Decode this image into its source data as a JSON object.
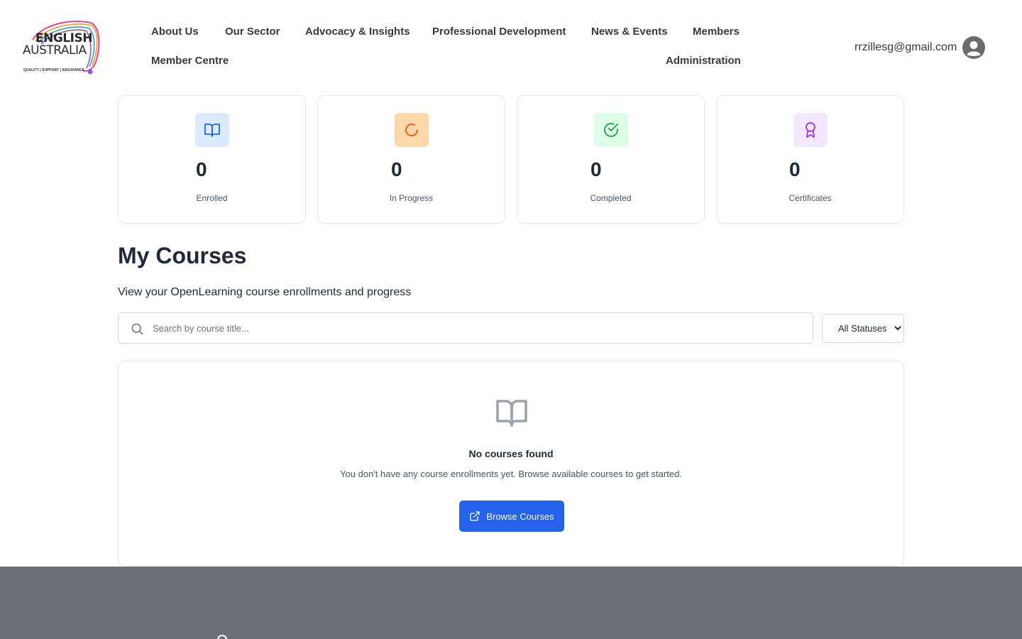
{
  "header": {
    "logo": {
      "line1": "ENGLISH",
      "line2": "AUSTRALIA",
      "tagline": "QUALITY | SUPPORT | ASSURANCE"
    },
    "nav": [
      {
        "label": "About Us"
      },
      {
        "label": "Our Sector"
      },
      {
        "label": "Advocacy & Insights"
      },
      {
        "label": "Professional Development"
      },
      {
        "label": "News & Events"
      },
      {
        "label": "Members"
      },
      {
        "label": "Member Centre"
      },
      {
        "label": "Administration"
      }
    ],
    "user_email": "rrzillesg@gmail.com",
    "avatar_icon": "user-circle-icon"
  },
  "stats": [
    {
      "value": "0",
      "label": "Enrolled",
      "icon": "book-open-icon",
      "bg": "#dbeafe",
      "color": "#2563eb"
    },
    {
      "value": "0",
      "label": "In Progress",
      "icon": "loader-icon",
      "bg": "#fed7aa",
      "color": "#ea580c"
    },
    {
      "value": "0",
      "label": "Completed",
      "icon": "check-circle-icon",
      "bg": "#dcfce7",
      "color": "#16a34a"
    },
    {
      "value": "0",
      "label": "Certificates",
      "icon": "award-icon",
      "bg": "#f3e8ff",
      "color": "#9333ea"
    }
  ],
  "main": {
    "title": "My Courses",
    "subtitle": "View your OpenLearning course enrollments and progress"
  },
  "filters": {
    "search_placeholder": "Search by course title...",
    "status_selected": "All Statuses"
  },
  "empty_state": {
    "icon": "book-open-icon",
    "title": "No courses found",
    "text": "You don't have any course enrollments yet. Browse available courses to get started.",
    "button_label": "Browse Courses",
    "button_icon": "external-link-icon",
    "accent": "#2563eb"
  },
  "footer": {
    "background": "#6d6e72"
  }
}
